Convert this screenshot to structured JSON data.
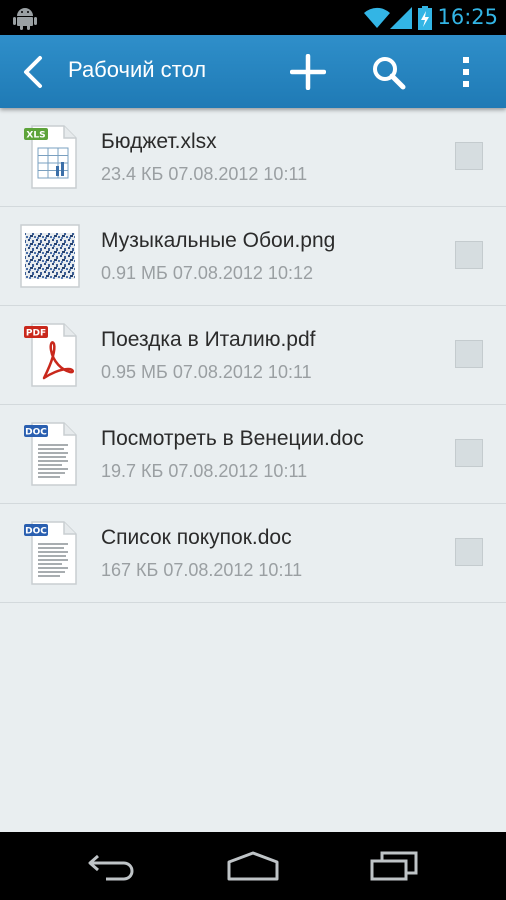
{
  "status_bar": {
    "time": "16:25"
  },
  "action_bar": {
    "title": "Рабочий стол",
    "icons": [
      "back-icon",
      "add-icon",
      "search-icon",
      "overflow-menu-icon"
    ]
  },
  "files": [
    {
      "name": "Бюджет.xlsx",
      "meta": "23.4 КБ 07.08.2012 10:11",
      "type_badge": "XLS",
      "icon": "spreadsheet-file-icon",
      "badge_color": "#5da33a"
    },
    {
      "name": "Музыкальные Обои.png",
      "meta": "0.91 МБ 07.08.2012 10:12",
      "icon": "image-thumbnail-icon"
    },
    {
      "name": "Поездка в Италию.pdf",
      "meta": "0.95 МБ 07.08.2012 10:11",
      "type_badge": "PDF",
      "icon": "pdf-file-icon",
      "badge_color": "#c9281c"
    },
    {
      "name": "Посмотреть в Венеции.doc",
      "meta": "19.7 КБ 07.08.2012 10:11",
      "type_badge": "DOC",
      "icon": "doc-file-icon",
      "badge_color": "#2a5fb0"
    },
    {
      "name": "Список покупок.doc",
      "meta": "167 КБ 07.08.2012 10:11",
      "type_badge": "DOC",
      "icon": "doc-file-icon",
      "badge_color": "#2a5fb0"
    }
  ],
  "colors": {
    "action_bar": "#2384c2",
    "background": "#e9eef0",
    "clock": "#33b5e5"
  }
}
